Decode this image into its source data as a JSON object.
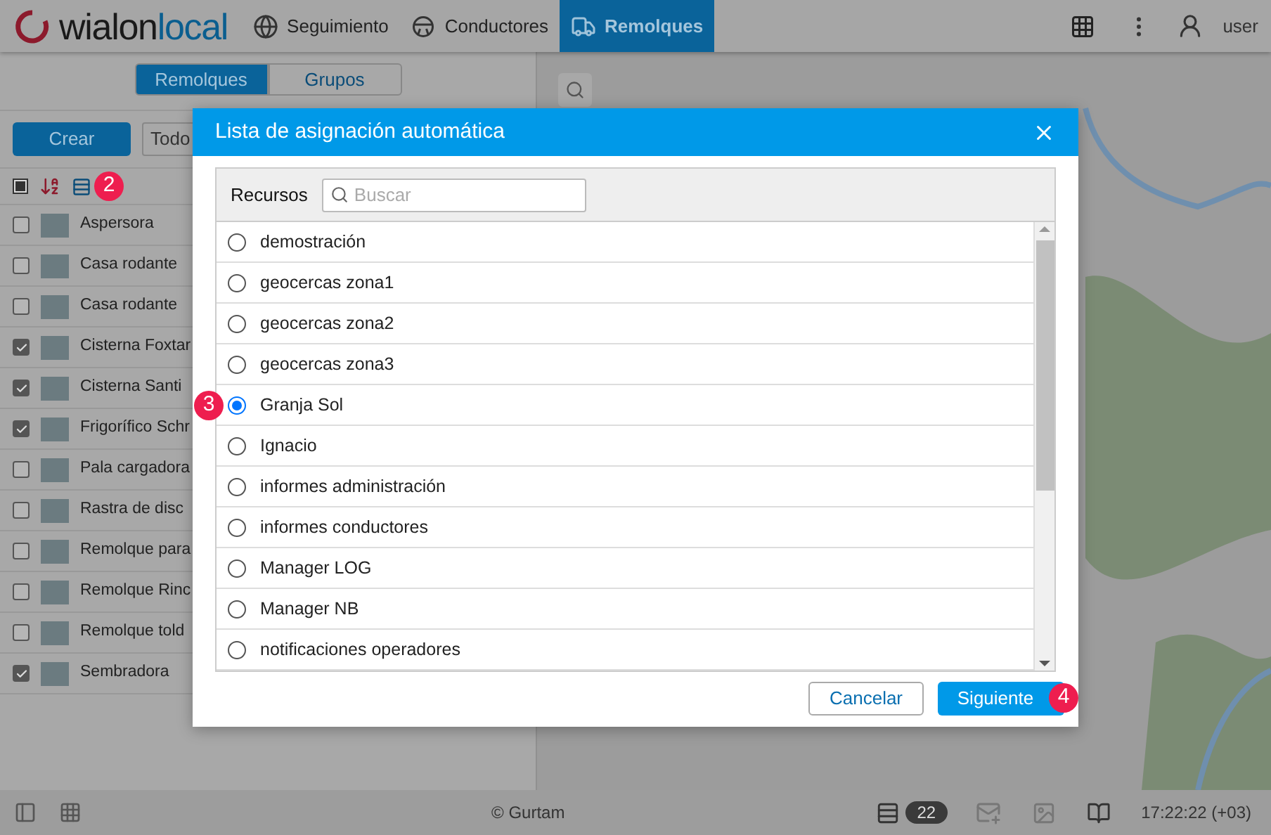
{
  "logo": {
    "part1": "wialon",
    "part2": "local"
  },
  "nav": [
    {
      "label": "Seguimiento",
      "kind": "globe",
      "selected": false
    },
    {
      "label": "Conductores",
      "kind": "wheel",
      "selected": false
    },
    {
      "label": "Remolques",
      "kind": "truck",
      "selected": true
    }
  ],
  "user": "user",
  "panel_tabs": [
    {
      "label": "Remolques",
      "selected": true
    },
    {
      "label": "Grupos",
      "selected": false
    }
  ],
  "create_button": "Crear",
  "filter": "Todo",
  "toolbar": {
    "indeterminate": true,
    "badge": "2"
  },
  "trailers": [
    {
      "name": "Aspersora",
      "checked": false
    },
    {
      "name": "Casa rodante",
      "checked": false
    },
    {
      "name": "Casa rodante",
      "checked": false
    },
    {
      "name": "Cisterna Foxtar",
      "checked": true
    },
    {
      "name": "Cisterna Santi",
      "checked": true
    },
    {
      "name": "Frigorífico Schr",
      "checked": true
    },
    {
      "name": "Pala cargadora",
      "checked": false
    },
    {
      "name": "Rastra de disc",
      "checked": false
    },
    {
      "name": "Remolque para",
      "checked": false
    },
    {
      "name": "Remolque Rinc",
      "checked": false
    },
    {
      "name": "Remolque told",
      "checked": false
    },
    {
      "name": "Sembradora",
      "checked": true
    }
  ],
  "dialog": {
    "title": "Lista de asignación automática",
    "resources_label": "Recursos",
    "search": {
      "placeholder": "Buscar"
    },
    "resources": [
      {
        "name": "demostración",
        "selected": false
      },
      {
        "name": "geocercas zona1",
        "selected": false
      },
      {
        "name": "geocercas zona2",
        "selected": false
      },
      {
        "name": "geocercas zona3",
        "selected": false
      },
      {
        "name": "Granja Sol",
        "selected": true
      },
      {
        "name": "Ignacio",
        "selected": false
      },
      {
        "name": "informes administración",
        "selected": false
      },
      {
        "name": "informes conductores",
        "selected": false
      },
      {
        "name": "Manager LOG",
        "selected": false
      },
      {
        "name": "Manager NB",
        "selected": false
      },
      {
        "name": "notificaciones operadores",
        "selected": false
      }
    ],
    "selected_badge": "3",
    "cancel": "Cancelar",
    "next": "Siguiente",
    "next_badge": "4"
  },
  "status_bar": {
    "copyright": "© Gurtam",
    "notifications": "22",
    "time": "17:22:22 (+03)"
  }
}
